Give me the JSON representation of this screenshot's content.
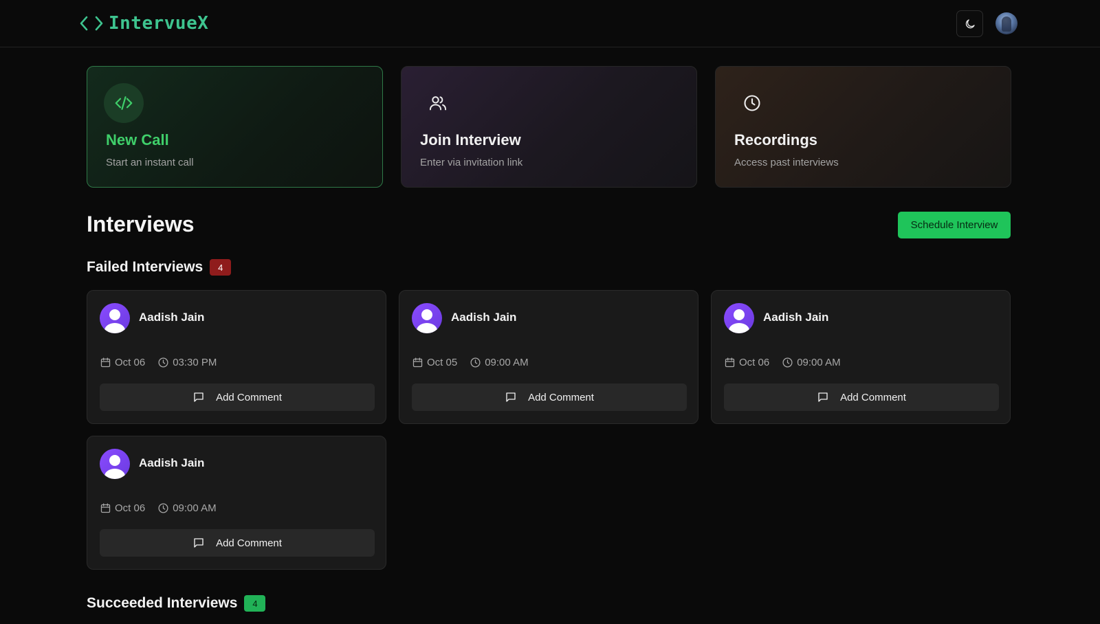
{
  "header": {
    "logo_text": "IntervueX",
    "logo_icon": "code-brackets-icon",
    "theme_icon": "moon-icon"
  },
  "actions": [
    {
      "title": "New Call",
      "subtitle": "Start an instant call",
      "icon": "code-icon",
      "accent": "#3fcf6a"
    },
    {
      "title": "Join Interview",
      "subtitle": "Enter via invitation link",
      "icon": "users-icon"
    },
    {
      "title": "Recordings",
      "subtitle": "Access past interviews",
      "icon": "clock-icon"
    }
  ],
  "main": {
    "title": "Interviews",
    "schedule_label": "Schedule Interview"
  },
  "failed": {
    "title": "Failed Interviews",
    "count": "4",
    "items": [
      {
        "name": "Aadish Jain",
        "date": "Oct 06",
        "time": "03:30 PM",
        "comment_label": "Add Comment"
      },
      {
        "name": "Aadish Jain",
        "date": "Oct 05",
        "time": "09:00 AM",
        "comment_label": "Add Comment"
      },
      {
        "name": "Aadish Jain",
        "date": "Oct 06",
        "time": "09:00 AM",
        "comment_label": "Add Comment"
      },
      {
        "name": "Aadish Jain",
        "date": "Oct 06",
        "time": "09:00 AM",
        "comment_label": "Add Comment"
      }
    ]
  },
  "succeeded": {
    "title": "Succeeded Interviews",
    "count": "4"
  },
  "colors": {
    "brand": "#3ec48f",
    "primary_button": "#1fc45a",
    "fail_badge": "#8f1c1c",
    "success_badge": "#21b257"
  }
}
